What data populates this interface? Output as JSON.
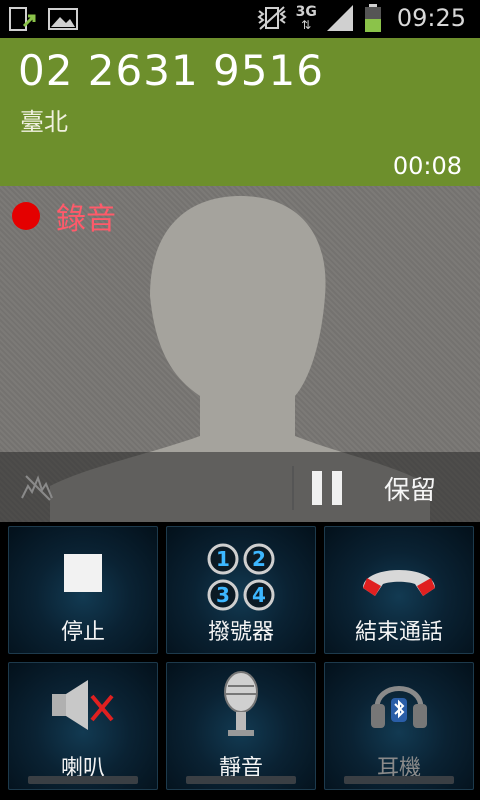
{
  "status_bar": {
    "time": "09:25",
    "network": "3G",
    "icons": [
      "sim-arrow-icon",
      "picture-icon",
      "vibrate-icon",
      "3g-icon",
      "signal-icon",
      "battery-icon"
    ]
  },
  "caller": {
    "number": "02 2631 9516",
    "location": "臺北",
    "duration": "00:08",
    "background_color": "#6d8f2c"
  },
  "recording": {
    "label": "錄音",
    "color": "#e40000"
  },
  "controls": {
    "hold_label": "保留"
  },
  "buttons": [
    {
      "label": "停止",
      "icon": "stop-icon"
    },
    {
      "label": "撥號器",
      "icon": "dialpad-icon"
    },
    {
      "label": "結束通話",
      "icon": "end-call-icon"
    },
    {
      "label": "喇叭",
      "icon": "speaker-muted-icon"
    },
    {
      "label": "靜音",
      "icon": "microphone-icon"
    },
    {
      "label": "耳機",
      "icon": "bluetooth-headset-icon",
      "disabled": true
    }
  ]
}
